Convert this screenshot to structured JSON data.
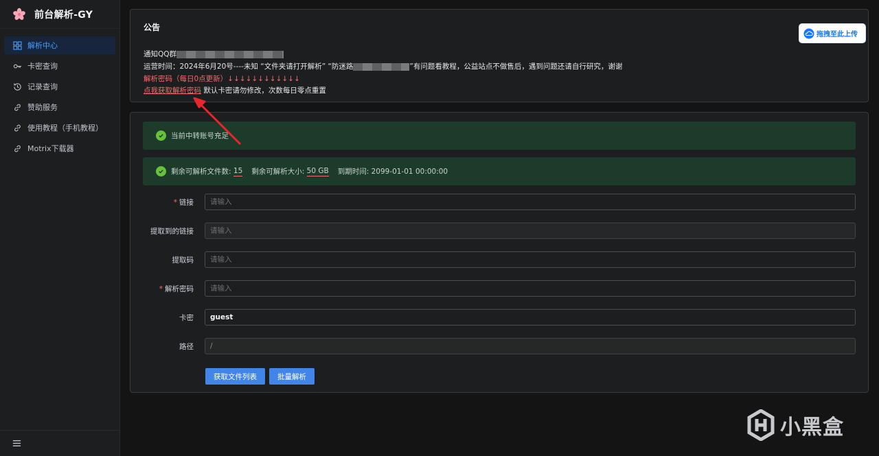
{
  "app": {
    "title": "前台解析-GY"
  },
  "sidebar": {
    "items": [
      {
        "label": "解析中心",
        "icon": "grid-icon",
        "active": true
      },
      {
        "label": "卡密查询",
        "icon": "key-icon"
      },
      {
        "label": "记录查询",
        "icon": "history-icon"
      },
      {
        "label": "赞助服务",
        "icon": "link-icon"
      },
      {
        "label": "使用教程（手机教程）",
        "icon": "link-icon"
      },
      {
        "label": "Motrix下载器",
        "icon": "link-icon"
      }
    ],
    "footer_icon": "hamburger-icon"
  },
  "announcement": {
    "title": "公告",
    "upload_button": "拖拽至此上传",
    "line1_prefix": "通知QQ群",
    "line2_a": "运营时间：2024年6月20号----未知 “文件夹请打开解析” “防迷路",
    "line2_b": "”有问题看教程，公益站点不做售后，遇到问题还请自行研究，谢谢",
    "line3": "解析密码（每日0点更新）↓↓↓↓↓↓↓↓↓↓↓↓",
    "line4_link": "点我获取解析密码",
    "line4_rest": "默认卡密请勿修改，次数每日零点重置"
  },
  "alerts": {
    "account_status": "当前中转账号充足",
    "files_label": "剩余可解析文件数:",
    "files_value": "15",
    "size_label": "剩余可解析大小:",
    "size_value": "50 GB",
    "expire_label": "到期时间:",
    "expire_value": "2099-01-01 00:00:00"
  },
  "form": {
    "link_label": "链接",
    "link_placeholder": "请输入",
    "extracted_label": "提取到的链接",
    "extracted_placeholder": "请输入",
    "code_label": "提取码",
    "code_placeholder": "请输入",
    "password_label": "解析密码",
    "password_placeholder": "请输入",
    "card_label": "卡密",
    "card_value": "guest",
    "path_label": "路径",
    "path_value": "/"
  },
  "buttons": {
    "get_list": "获取文件列表",
    "batch": "批量解析"
  },
  "colors": {
    "accent": "#409eff",
    "button": "#4285e8",
    "danger": "#f56c6c",
    "success_bg": "#1c3b2b",
    "success_icon": "#67c23a"
  },
  "watermark": {
    "text": "小黑盒"
  }
}
